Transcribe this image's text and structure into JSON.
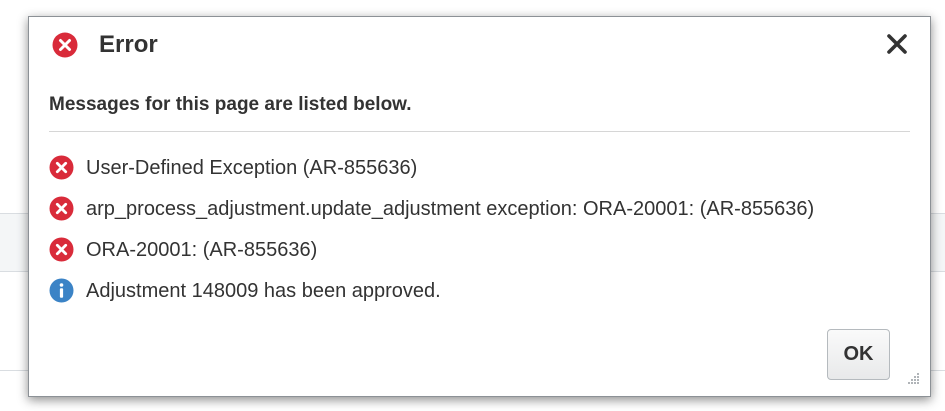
{
  "dialog": {
    "title": "Error",
    "subtitle": "Messages for this page are listed below.",
    "close_icon": "close-icon",
    "ok_label": "OK",
    "messages": [
      {
        "type": "error",
        "icon": "error-circle-icon",
        "text": "User-Defined Exception (AR-855636)"
      },
      {
        "type": "error",
        "icon": "error-circle-icon",
        "text": "arp_process_adjustment.update_adjustment exception: ORA-20001: (AR-855636)"
      },
      {
        "type": "error",
        "icon": "error-circle-icon",
        "text": "ORA-20001: (AR-855636)"
      },
      {
        "type": "info",
        "icon": "info-circle-icon",
        "text": "Adjustment 148009 has been approved."
      }
    ]
  },
  "colors": {
    "error": "#d92b3a",
    "info": "#3b83c6",
    "text": "#333333"
  }
}
